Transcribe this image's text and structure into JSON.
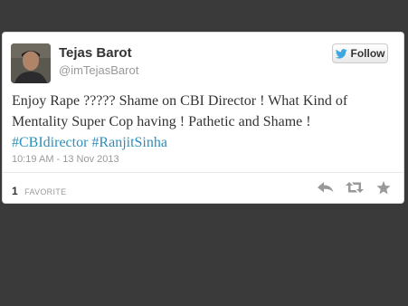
{
  "tweet": {
    "display_name": "Tejas Barot",
    "screen_name": "@imTejasBarot",
    "follow_label": "Follow",
    "text": "Enjoy Rape ????? Shame on CBI Director ! What Kind of Mentality Super Cop having ! Pathetic and Shame !",
    "hashtags": [
      "#CBIdirector",
      "#RanjitSinha"
    ],
    "timestamp": "10:19 AM - 13 Nov 2013",
    "favorites_count": "1",
    "favorites_label": "FAVORITE"
  },
  "icons": {
    "follow": "bird-icon",
    "reply": "reply-icon",
    "retweet": "retweet-icon",
    "favorite": "star-icon"
  },
  "colors": {
    "background": "#3a3a3a",
    "hashtag": "#2a8fbd",
    "bird": "#3ea6e0",
    "action_icon": "#999999"
  }
}
